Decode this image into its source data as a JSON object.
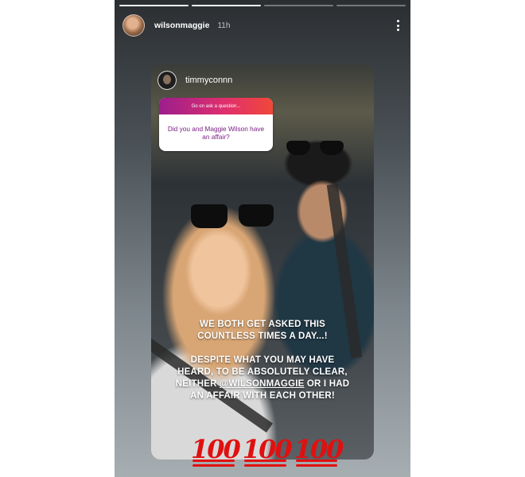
{
  "story": {
    "username": "wilsonmaggie",
    "time": "11h",
    "progress": [
      1,
      1,
      0,
      0
    ]
  },
  "reply": {
    "username": "timmyconnn"
  },
  "question_sticker": {
    "prompt": "Go on ask a question...",
    "question": "Did you and Maggie Wilson have an affair?"
  },
  "overlay": {
    "line1": "WE BOTH GET ASKED THIS",
    "line2": "COUNTLESS TIMES A DAY...!",
    "line3": "DESPITE WHAT YOU MAY HAVE",
    "line4": "HEARD, TO BE ABSOLUTELY CLEAR,",
    "line5_prefix": "NEITHER ",
    "line5_mention": "@WILSONMAGGIE",
    "line5_suffix": " OR I HAD",
    "line6": "AN AFFAIR WITH EACH OTHER!"
  },
  "emoji": {
    "glyph": "100",
    "count": 3,
    "color": "#e01010"
  },
  "colors": {
    "question_gradient": [
      "#9c1e8c",
      "#e1306c",
      "#f04838"
    ],
    "question_text": "#7a1f84"
  }
}
